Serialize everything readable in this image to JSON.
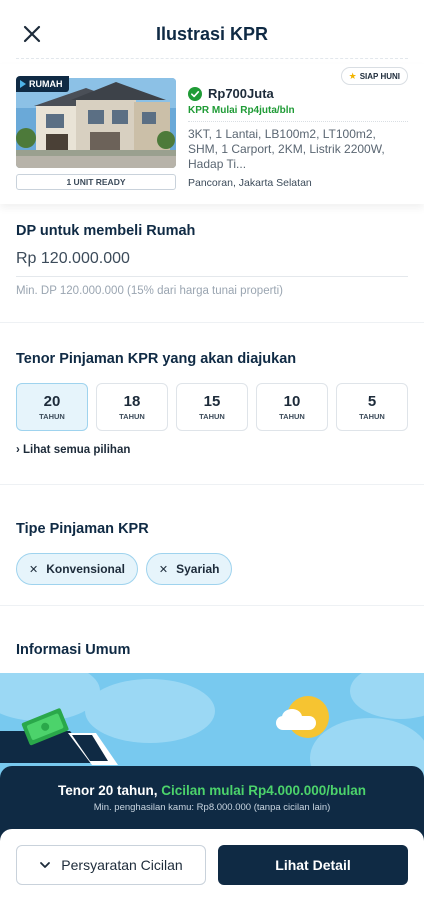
{
  "header": {
    "title": "Ilustrasi KPR",
    "close_icon": "close-icon"
  },
  "listing": {
    "property_type_badge": "RUMAH",
    "availability_badge": "SIAP HUNI",
    "price": "Rp700Juta",
    "kpr_start": "KPR Mulai Rp4juta/bln",
    "specs": "3KT, 1 Lantai,  LB100m2, LT100m2, SHM, 1 Carport, 2KM, Listrik 2200W, Hadap Ti...",
    "location": "Pancoran, Jakarta Selatan",
    "unit_ready": "1 UNIT READY",
    "verified_icon": "verified-check-icon"
  },
  "dp": {
    "title": "DP untuk membeli Rumah",
    "currency": "Rp",
    "value": "120.000.000",
    "min_note": "Min. DP 120.000.000 (15% dari harga tunai properti)"
  },
  "tenor": {
    "title": "Tenor Pinjaman KPR yang akan diajukan",
    "options": [
      {
        "value": "20",
        "unit": "TAHUN",
        "selected": true
      },
      {
        "value": "18",
        "unit": "TAHUN",
        "selected": false
      },
      {
        "value": "15",
        "unit": "TAHUN",
        "selected": false
      },
      {
        "value": "10",
        "unit": "TAHUN",
        "selected": false
      },
      {
        "value": "5",
        "unit": "TAHUN",
        "selected": false
      }
    ],
    "see_all": "› Lihat semua pilihan"
  },
  "loan_type": {
    "title": "Tipe Pinjaman KPR",
    "chips": [
      "Konvensional",
      "Syariah"
    ]
  },
  "general_info": {
    "title": "Informasi Umum"
  },
  "summary": {
    "tenor_text": "Tenor 20 tahun, ",
    "installment_text": "Cicilan mulai Rp4.000.000/bulan",
    "min_income": "Min. penghasilan kamu: Rp8.000.000 (tanpa cicilan lain)"
  },
  "actions": {
    "requirements_label": "Persyaratan Cicilan",
    "detail_label": "Lihat Detail"
  },
  "colors": {
    "primary_navy": "#0f2a44",
    "accent_green": "#1f9b36",
    "highlight_green": "#4cd36b",
    "selected_bg": "#e6f4fb",
    "sky_blue": "#78c9ef"
  }
}
